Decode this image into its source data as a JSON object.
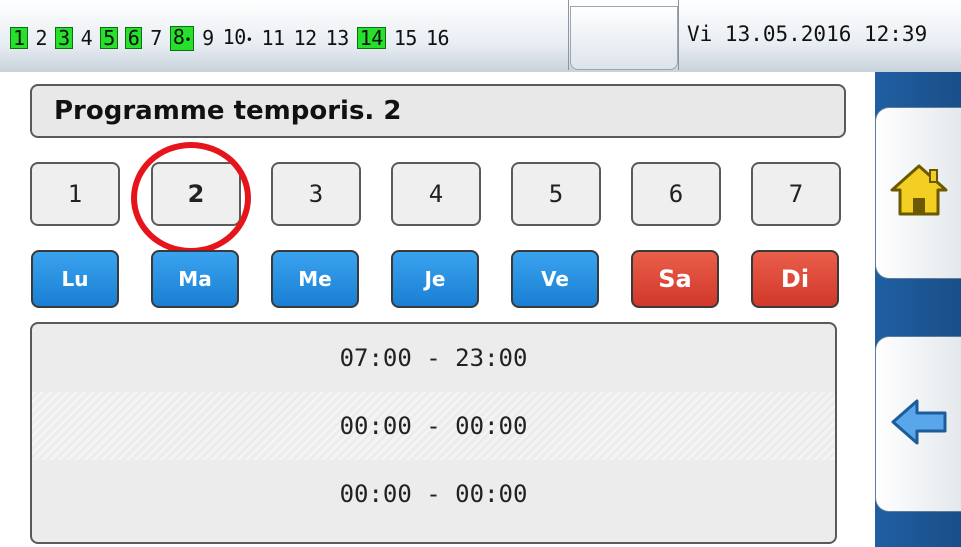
{
  "status_bar": {
    "outputs": [
      {
        "label": "1",
        "active": true,
        "arrow": false
      },
      {
        "label": "2",
        "active": false,
        "arrow": false
      },
      {
        "label": "3",
        "active": true,
        "arrow": false
      },
      {
        "label": "4",
        "active": false,
        "arrow": false
      },
      {
        "label": "5",
        "active": true,
        "arrow": false
      },
      {
        "label": "6",
        "active": true,
        "arrow": false
      },
      {
        "label": "7",
        "active": false,
        "arrow": false
      },
      {
        "label": "8",
        "active": true,
        "arrow": true
      },
      {
        "label": "9",
        "active": false,
        "arrow": false
      },
      {
        "label": "10",
        "active": false,
        "arrow": true
      },
      {
        "label": "11",
        "active": false,
        "arrow": false
      },
      {
        "label": "12",
        "active": false,
        "arrow": false
      },
      {
        "label": "13",
        "active": false,
        "arrow": false
      },
      {
        "label": "14",
        "active": true,
        "arrow": false
      },
      {
        "label": "15",
        "active": false,
        "arrow": false
      },
      {
        "label": "16",
        "active": false,
        "arrow": false
      }
    ],
    "datetime": "Vi  13.05.2016 12:39",
    "active_color": "#27e02b"
  },
  "title": "Programme temporis. 2",
  "slots": [
    {
      "label": "1",
      "selected": false
    },
    {
      "label": "2",
      "selected": true
    },
    {
      "label": "3",
      "selected": false
    },
    {
      "label": "4",
      "selected": false
    },
    {
      "label": "5",
      "selected": false
    },
    {
      "label": "6",
      "selected": false
    },
    {
      "label": "7",
      "selected": false
    }
  ],
  "days": [
    {
      "label": "Lu",
      "weekend": false
    },
    {
      "label": "Ma",
      "weekend": false
    },
    {
      "label": "Me",
      "weekend": false
    },
    {
      "label": "Je",
      "weekend": false
    },
    {
      "label": "Ve",
      "weekend": false
    },
    {
      "label": "Sa",
      "weekend": true
    },
    {
      "label": "Di",
      "weekend": true
    }
  ],
  "time_ranges": [
    "07:00  -  23:00",
    "00:00  -  00:00",
    "00:00  -  00:00"
  ],
  "sidebar": {
    "home_icon": "home-icon",
    "back_icon": "back-arrow-icon"
  },
  "colors": {
    "weekday": "#1a7fd3",
    "weekend": "#d1382a",
    "highlight_circle": "#e6151b",
    "sidebar": "#1f5fa2"
  }
}
